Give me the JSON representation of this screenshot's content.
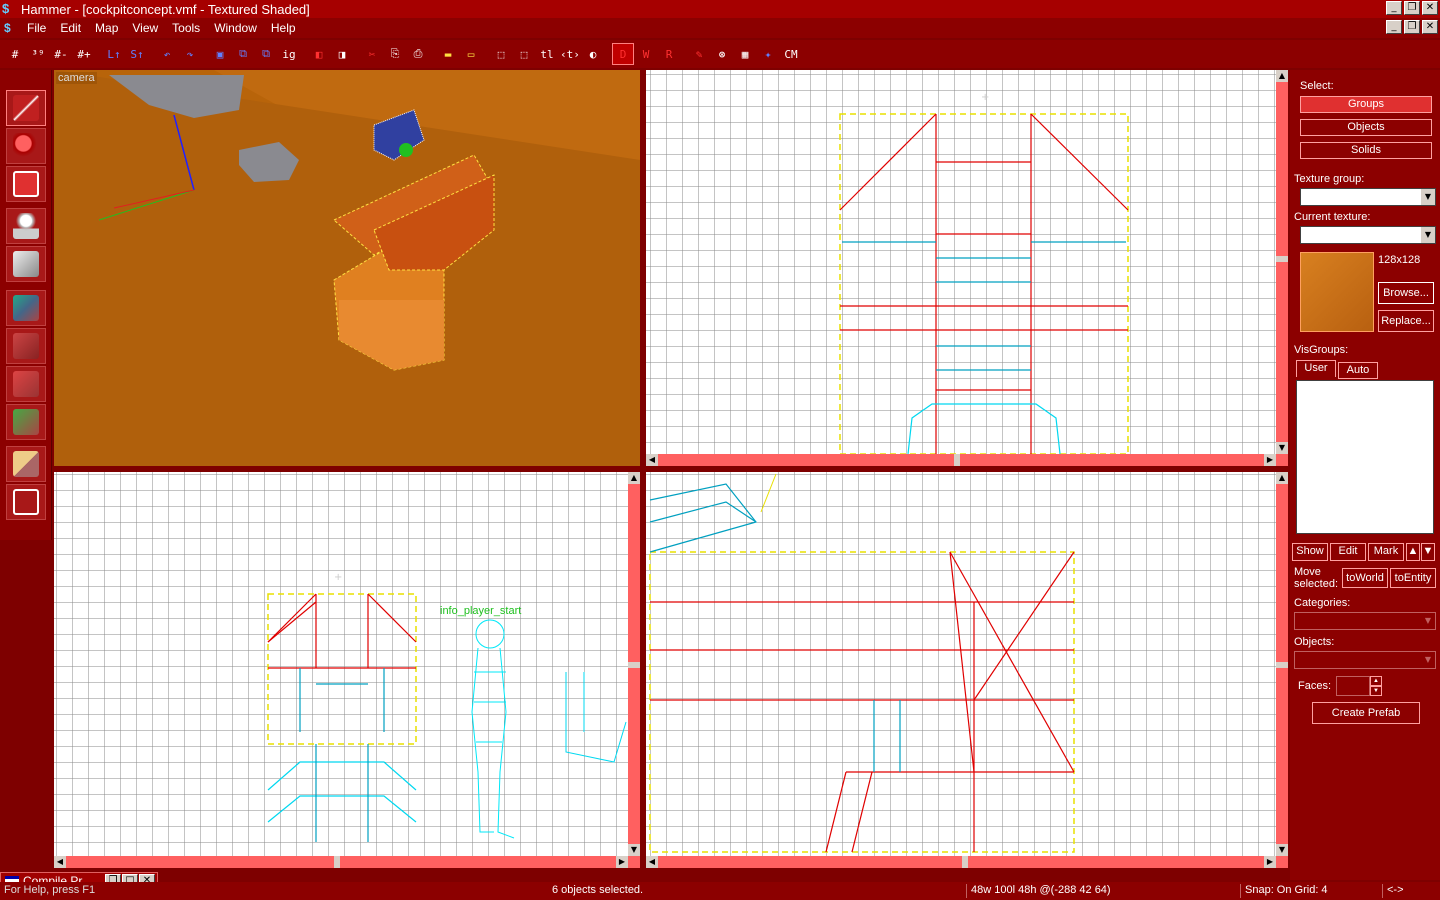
{
  "window": {
    "app_icon": "hammer-icon",
    "title": "Hammer - [cockpitconcept.vmf - Textured Shaded]",
    "controls": [
      "_",
      "❐",
      "✕"
    ]
  },
  "menubar": {
    "items": [
      "File",
      "Edit",
      "Map",
      "View",
      "Tools",
      "Window",
      "Help"
    ],
    "child_controls": [
      "_",
      "❐",
      "✕"
    ]
  },
  "toolbar": {
    "buttons": [
      "#",
      "³⁹",
      "#-",
      "#+",
      "L↑",
      "S↑",
      "↶",
      "↷",
      "▣",
      "⧉",
      "⧉",
      "ig",
      "◧",
      "◨",
      "✂",
      "⎘",
      "⎙",
      "▬",
      "▭",
      "⬚",
      "⬚",
      "tl",
      "‹t›",
      "◐",
      "D",
      "W",
      "R",
      "✎",
      "⊛",
      "▦",
      "✦",
      "CM"
    ]
  },
  "tools": [
    {
      "name": "selection-tool",
      "icon": "arrow-pointer-icon"
    },
    {
      "name": "magnify-tool",
      "icon": "magnifier-icon"
    },
    {
      "name": "camera-tool",
      "icon": "camera-icon"
    },
    {
      "name": "entity-tool",
      "icon": "entity-icon"
    },
    {
      "name": "block-tool",
      "icon": "block-icon"
    },
    {
      "name": "texture-tool",
      "icon": "texture-app-icon"
    },
    {
      "name": "apply-texture-tool",
      "icon": "apply-texture-icon"
    },
    {
      "name": "decal-tool",
      "icon": "decal-icon"
    },
    {
      "name": "overlay-tool",
      "icon": "overlay-icon"
    },
    {
      "name": "clipping-tool",
      "icon": "clip-icon"
    },
    {
      "name": "vertex-tool",
      "icon": "vertex-icon"
    }
  ],
  "viewports": {
    "camera_label": "camera",
    "entity_label": "info_player_start"
  },
  "right_panel": {
    "select_label": "Select:",
    "select_buttons": [
      "Groups",
      "Objects",
      "Solids"
    ],
    "texture_group_label": "Texture group:",
    "current_texture_label": "Current texture:",
    "texture_size": "128x128",
    "browse_button": "Browse...",
    "replace_button": "Replace...",
    "visgroups_label": "VisGroups:",
    "visgroups_tabs": [
      "User",
      "Auto"
    ],
    "vis_buttons": [
      "Show",
      "Edit",
      "Mark"
    ],
    "move_selected_label": "Move\nselected:",
    "to_world_button": "toWorld",
    "to_entity_button": "toEntity",
    "categories_label": "Categories:",
    "objects_label": "Objects:",
    "faces_label": "Faces:",
    "create_prefab_button": "Create Prefab"
  },
  "compile_window": {
    "title": "Compile Pr..."
  },
  "statusbar": {
    "help": "For Help, press F1",
    "selection": "6 objects selected.",
    "dimensions": "48w 100l 48h @(-288 42 64)",
    "snap": "Snap: On Grid: 4",
    "extra": "<->"
  },
  "colors": {
    "theme_red": "#8c0000",
    "scrollbar": "#ff6060",
    "brush_red": "#e00000",
    "entity_cyan": "#00d8f0",
    "selection_yellow": "#e8e000"
  }
}
